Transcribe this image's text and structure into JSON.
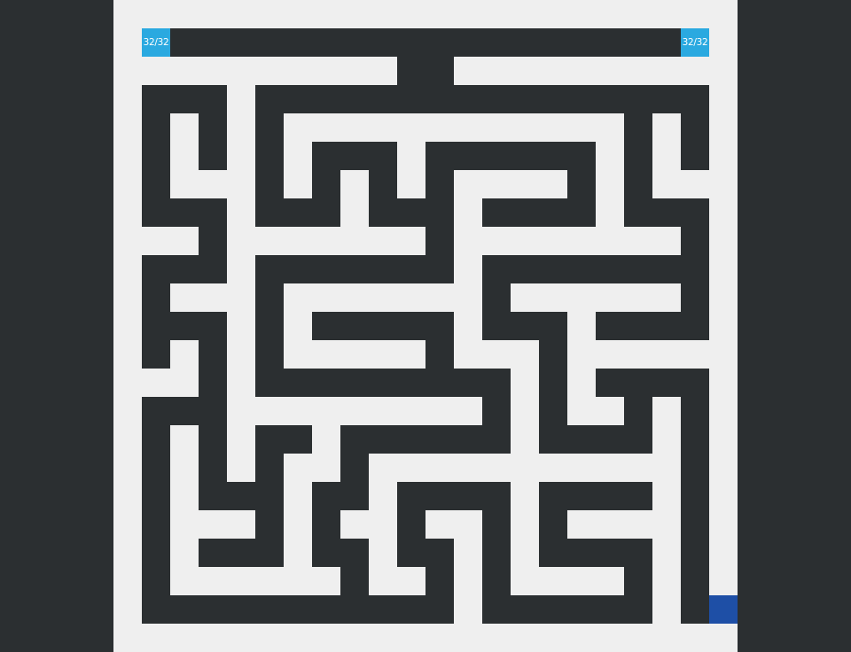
{
  "game": {
    "theme": {
      "background": "#2b2f31",
      "board": "#efefef",
      "wall": "#2b2f31",
      "badge": "#2aa9e0",
      "player": "#1e4fa6"
    },
    "badges": {
      "left": "32/32",
      "right": "32/32"
    }
  }
}
